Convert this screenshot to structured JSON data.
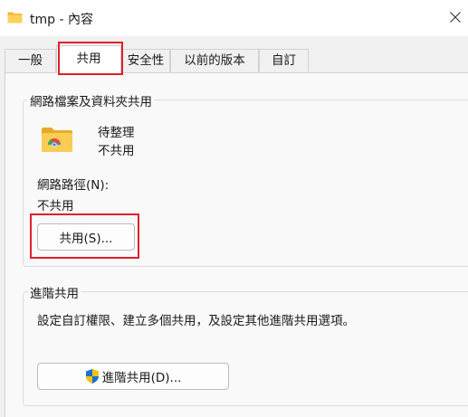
{
  "window": {
    "title": "tmp - 內容",
    "folder_icon": "folder-icon",
    "close_icon": "close-icon"
  },
  "tabs": [
    {
      "label": "一般",
      "active": false
    },
    {
      "label": "共用",
      "active": true
    },
    {
      "label": "安全性",
      "active": false
    },
    {
      "label": "以前的版本",
      "active": false
    },
    {
      "label": "自訂",
      "active": false
    }
  ],
  "network_sharing": {
    "group_title": "網路檔案及資料夾共用",
    "folder_name": "待整理",
    "status": "不共用",
    "path_label": "網路路徑(N):",
    "path_value": "不共用",
    "share_button": "共用(S)..."
  },
  "advanced_sharing": {
    "group_title": "進階共用",
    "description": "設定自訂權限、建立多個共用，及設定其他進階共用選項。",
    "button": "進階共用(D)...",
    "button_icon": "uac-shield-icon"
  },
  "colors": {
    "highlight": "#e0202a",
    "folder": "#f5c242",
    "accent": "#0067c0"
  }
}
